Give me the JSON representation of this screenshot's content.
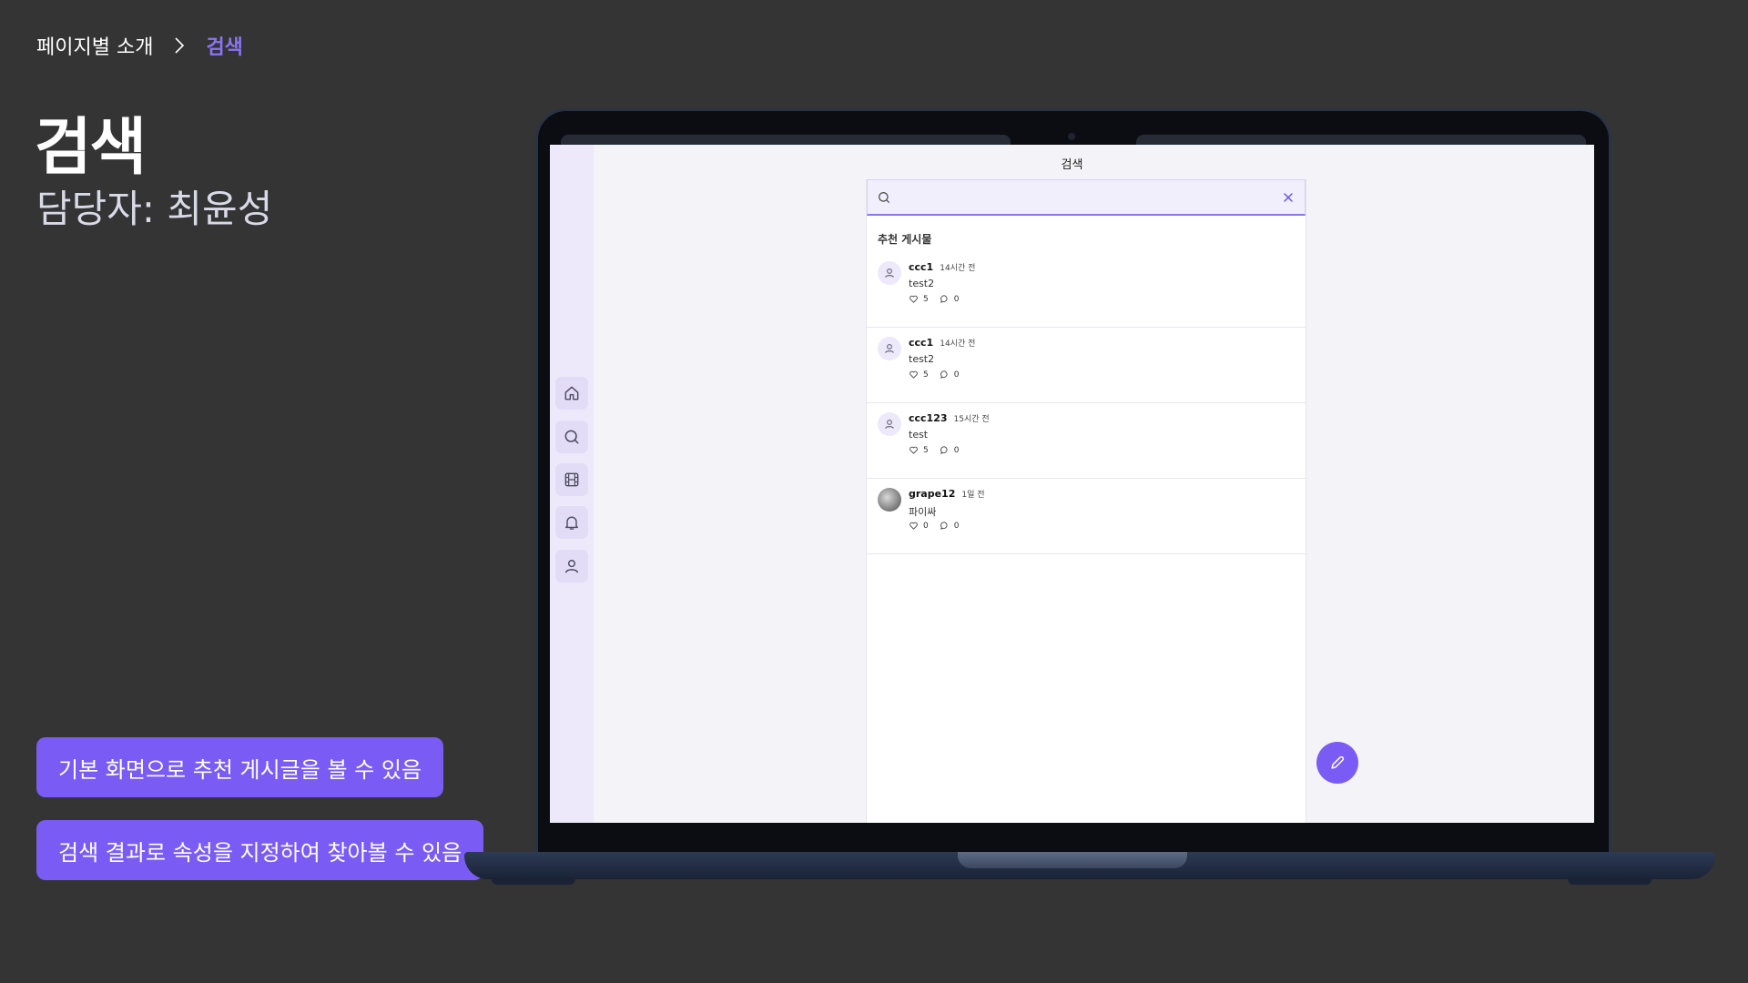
{
  "breadcrumb": {
    "parent": "페이지별 소개",
    "current": "검색"
  },
  "slide": {
    "title": "검색",
    "owner": "담당자: 최윤성"
  },
  "callouts": [
    "기본 화면으로 추천 게시글을 볼 수 있음",
    "검색 결과로 속성을 지정하여 찾아볼 수 있음"
  ],
  "app": {
    "title": "검색",
    "search": {
      "value": "",
      "placeholder": ""
    },
    "section_label": "추천 게시물",
    "nav": [
      "home-icon",
      "search-icon",
      "film-icon",
      "bell-icon",
      "user-icon"
    ],
    "posts": [
      {
        "author": "ccc1",
        "time": "14시간 전",
        "content": "test2",
        "likes": "5",
        "comments": "0",
        "avatar": "default"
      },
      {
        "author": "ccc1",
        "time": "14시간 전",
        "content": "test2",
        "likes": "5",
        "comments": "0",
        "avatar": "default"
      },
      {
        "author": "ccc123",
        "time": "15시간 전",
        "content": "test",
        "likes": "5",
        "comments": "0",
        "avatar": "default"
      },
      {
        "author": "grape12",
        "time": "1일 전",
        "content": "파이싸",
        "likes": "0",
        "comments": "0",
        "avatar": "photo"
      }
    ],
    "accent_color": "#7a5cf5"
  }
}
